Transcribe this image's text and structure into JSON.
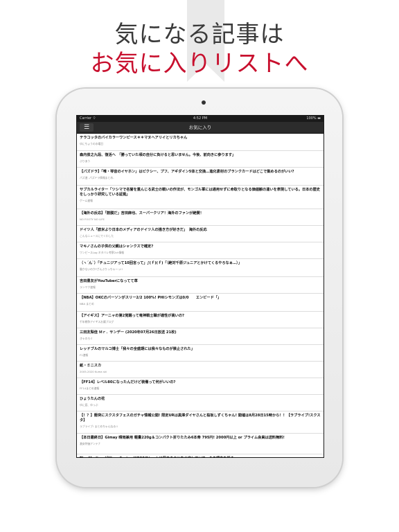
{
  "headline": {
    "line1": "気になる記事は",
    "line2": "お気に入りリストへ"
  },
  "colors": {
    "accent": "#c8102e",
    "navbar": "#2c2c2c",
    "statusbar": "#1a1a1a"
  },
  "device": {
    "status_bar": {
      "carrier": "Carrier ⌔",
      "time": "4:52 PM",
      "battery": "100% ▬"
    },
    "nav": {
      "menu_icon": "hamburger-icon",
      "title": "お気に入り"
    }
  },
  "articles": [
    {
      "title": "テラコッタのバイカラーワンピース＊＊マヌヘアリイとリカちゃん",
      "source": "ゆにちょうの水曜日"
    },
    {
      "title": "森内俊之九段、復活へ　「勝っていた頃の自分に負けると思いません。今後、前向きに参ります」",
      "source": "ぶりあう"
    },
    {
      "title": "【パズドラ】「唯・琴音のイヤホン」はピクシー、プフ、アギダイン5体と交換…進化素材のブランクカードはどこで集めるのがいい?",
      "source": "パズ速 -パズドラ情報まとめ-"
    },
    {
      "title": "サブカルライター「ツシマで名誉を重んじる武士の戦いの作法が、モンゴル軍には通用せずに命取りとなる価値観の違いを表現している。日本の歴史をしっかり研究している証拠」",
      "source": "ゲーム速報"
    },
    {
      "title": "【海外の反応】「鼓膜だ」吉田麻也、スーパークリア！海外のファンが絶賛！",
      "source": "NO FOOTY NO LIFE"
    },
    {
      "title": "ドイツ人「欧米より日本のメディアのドイツ人の描き方が好きだ」　海外の反応",
      "source": "こんなニュースにでくわした"
    },
    {
      "title": "マキノさんの子供の父親はシャンクスで確定?",
      "source": "ワンピースLog ネタバレ考察2ch情報"
    },
    {
      "title": "（ヽ´ん`）「チュニジアって10回言って」∫(ｆ)(ｆ)「（絶対千原ジュニアとかけてくるやろなぁ…）」",
      "source": "働かないのか?ざんぷりっちゃーっ!!"
    },
    {
      "title": "吉田豊友がYouTuberになってて草",
      "source": "ランヤク速報"
    },
    {
      "title": "【NBA】OKCのバーソンがスリー2/2 100%! PHIシモンズは0/0　　エンビード「」",
      "source": "NBA まとめ"
    },
    {
      "title": "【アイギス】アーニャの第2覚醒って竜神戦士職が適性が高いの?",
      "source": "千年戦争アイギスお嬢ブログ"
    },
    {
      "title": "三田友梨佳 Ｍｒ．サンデー (2020年07月26日放送 21枚)",
      "source": "きゃのろぐ"
    },
    {
      "title": "レッドブルのマルコ博士「我々の全盛期には我々なものが禁止された」",
      "source": "F1速報"
    },
    {
      "title": "紙・ミニスカ",
      "source": "2005-2020 Kuma ski"
    },
    {
      "title": "【FF14】レベル80になったんだけど装備って何がいいの?",
      "source": "FF14まとめ速報"
    },
    {
      "title": "ひょうたんの花",
      "source": "ゆに庭、ゆっぷ"
    },
    {
      "title": "【！？】衝突にスクスタフェスのガチャ情報公開! 限定URは黒澤ダイヤさんと桜坂しずくちゃん! 開催は8月28日15時から！！【ラブライブ!スクスタ】",
      "source": "ラブライブ! まとめちゃんねる!!"
    },
    {
      "title": "【本日最終日】Gimay 晴雨兼用 軽量220g＆コンパクト折りたたみ6本骨 795円! 2000円以上 or プライム会員は送料無料!",
      "source": "激安特価アンテナ"
    },
    {
      "title": "The MediumがXbox Series Xで30フレームに留まることを公言していて、その理由を語る",
      "source": ""
    }
  ]
}
